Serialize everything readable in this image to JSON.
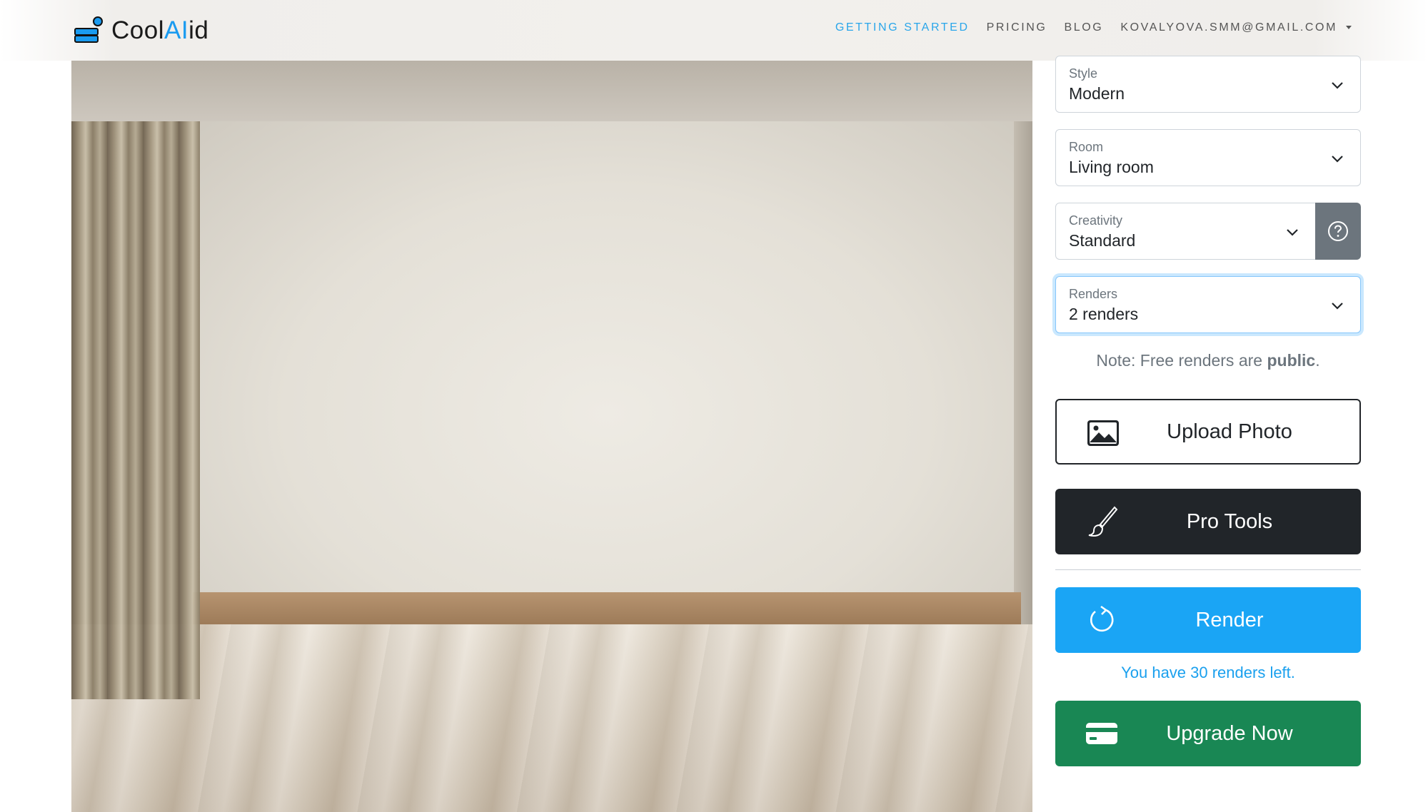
{
  "brand": {
    "name_prefix": "Cool",
    "name_ai": "AI",
    "name_suffix": "id"
  },
  "nav": {
    "links": [
      "GETTING STARTED",
      "PRICING",
      "BLOG"
    ],
    "account": "KOVALYOVA.SMM@GMAIL.COM"
  },
  "controls": {
    "style": {
      "label": "Style",
      "value": "Modern"
    },
    "room": {
      "label": "Room",
      "value": "Living room"
    },
    "creativity": {
      "label": "Creativity",
      "value": "Standard"
    },
    "renders": {
      "label": "Renders",
      "value": "2 renders"
    }
  },
  "note": {
    "prefix": "Note: Free renders are ",
    "bold": "public",
    "suffix": "."
  },
  "buttons": {
    "upload": "Upload Photo",
    "pro_tools": "Pro Tools",
    "render": "Render",
    "upgrade": "Upgrade Now"
  },
  "renders_left": "You have 30 renders left.",
  "colors": {
    "accent_blue": "#1aa5f5",
    "nav_active": "#2aa6ea",
    "upgrade_green": "#198754",
    "pro_dark": "#212529",
    "help_gray": "#6c757d"
  },
  "icons": {
    "brand": "stacked-boxes-icon",
    "help": "question-circle-icon",
    "upload": "image-icon",
    "pro_tools": "brush-icon",
    "render": "refresh-icon",
    "upgrade": "credit-card-icon",
    "select": "chevron-down-icon"
  }
}
